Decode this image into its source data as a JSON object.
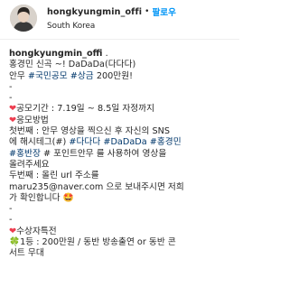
{
  "header": {
    "username": "hongkyungmin_offi",
    "separator": "•",
    "follow_label": "팔로우",
    "location": "South Korea"
  },
  "caption": {
    "owner": "hongkyungmin_offi",
    "owner_suffix": " .",
    "line_title": "홍경민 신곡 ~! DaDaDa(다다다)",
    "line_dance_prefix": "안무 ",
    "tag_contest": "#국민공모",
    "tag_prize": "#상금",
    "line_dance_suffix": " 200만원!",
    "dash1": "-",
    "dash2": "-",
    "heart_icon": "❤",
    "period_text": "공모기간 : 7.19일 ~ 8.5일 자정까지",
    "method_title": "응모방법",
    "step1_a": "첫번째 : 안무 영상을 찍으신 후 자신의 SNS",
    "step1_b_prefix": "에 해시테그(#) ",
    "tag_dadada_kr": "#다다다",
    "tag_dadada_en": "#DaDaDa",
    "tag_hkm": "#홍경민",
    "tag_hbj": "#홍반장",
    "step1_c_suffix": " # 포인트안무 를 사용하여 영상을",
    "step1_d": "올려주세요",
    "step2_a": "두번째 : 올린 url 주소를",
    "step2_b": "maru235@naver.com 으로 보내주시면 저희",
    "step2_c": "가 확인합니다",
    "smile_icon": "🤩",
    "dash3": "-",
    "dash4": "-",
    "award_title": "수상자특전",
    "clover_icon": "🍀",
    "award_line1": "1등 : 200만원 / 동반 방송출연 or 동반 콘",
    "award_line2": "서트 무대"
  }
}
